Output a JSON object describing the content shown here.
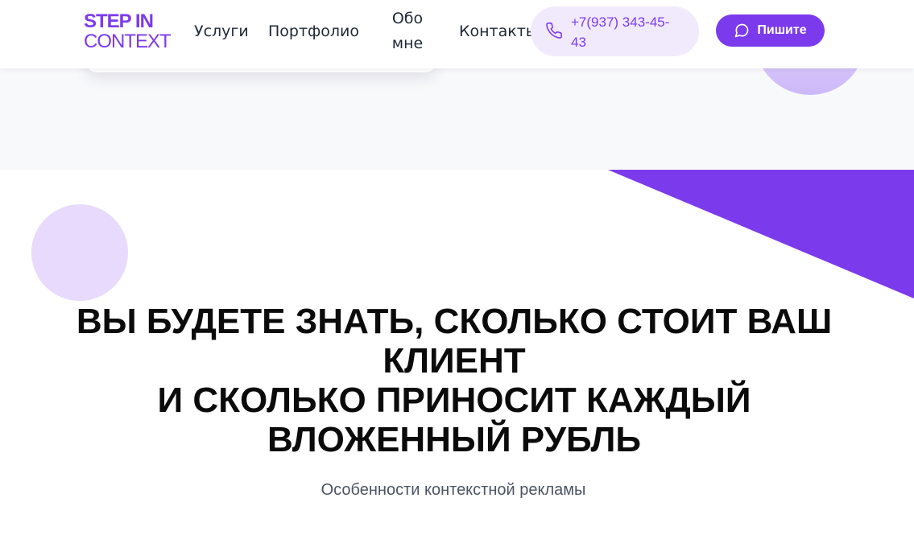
{
  "header": {
    "logo": {
      "line1": "STEP IN",
      "line2": "CONTEXT"
    },
    "nav": [
      {
        "label": "Услуги"
      },
      {
        "label": "Портфолио"
      },
      {
        "label": "Обо мне"
      },
      {
        "label": "Контакты"
      }
    ],
    "phone": {
      "number": "+7(937) 343-45-43",
      "icon": "phone-icon"
    },
    "cta": {
      "label": "Пишите",
      "icon": "chat-bubble-icon"
    }
  },
  "hero": {
    "title_lines": [
      "ВЫ БУДЕТЕ ЗНАТЬ, СКОЛЬКО СТОИТ ВАШ КЛИЕНТ",
      "И СКОЛЬКО ПРИНОСИТ КАЖДЫЙ ВЛОЖЕННЫЙ РУБЛЬ"
    ],
    "subtitle": "Особенности контекстной рекламы"
  },
  "colors": {
    "accent": "#7c3aed",
    "accent_light": "#f1eafd",
    "circle": "#e8dafd",
    "text_dark": "#0b0b0b",
    "text_muted": "#4b5563",
    "section_bg": "#f8f9fb"
  }
}
